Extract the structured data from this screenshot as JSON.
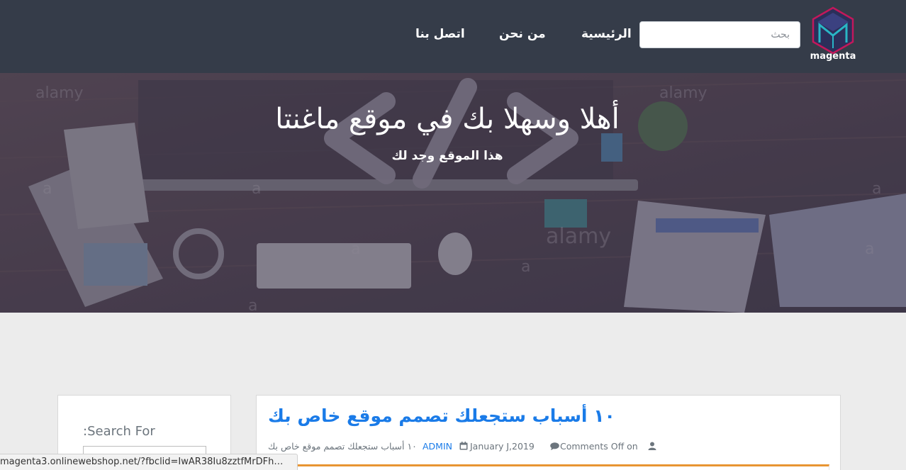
{
  "brand": {
    "name": "magenta",
    "logo_icon": "magenta-cube-logo-icon"
  },
  "search": {
    "placeholder": "بحث"
  },
  "nav": {
    "home": "الرئيسية",
    "about": "من نحن",
    "contact": "اتصل بنا"
  },
  "hero": {
    "title": "أهلا وسهلا بك في موقع ماغنتا",
    "subtitle": "هذا الموقع وجد لك"
  },
  "sidebar": {
    "title": ":Search For"
  },
  "post": {
    "title": "١٠ أسباب ستجعلك تصمم موقع خاص بك",
    "ref": "١٠ أسباب ستجعلك تصمم موقع خاص بك",
    "author": "ADMIN",
    "date": "January J,2019",
    "comments": "Comments Off on"
  },
  "statusbar": {
    "url": "magenta3.onlinewebshop.net/?fbclid=IwAR38Iu8zztfMrDFh…"
  },
  "colors": {
    "navbar": "#353c49",
    "link": "#1a7be8",
    "accent_bar": "#e89532",
    "page_bg": "#ececec"
  }
}
